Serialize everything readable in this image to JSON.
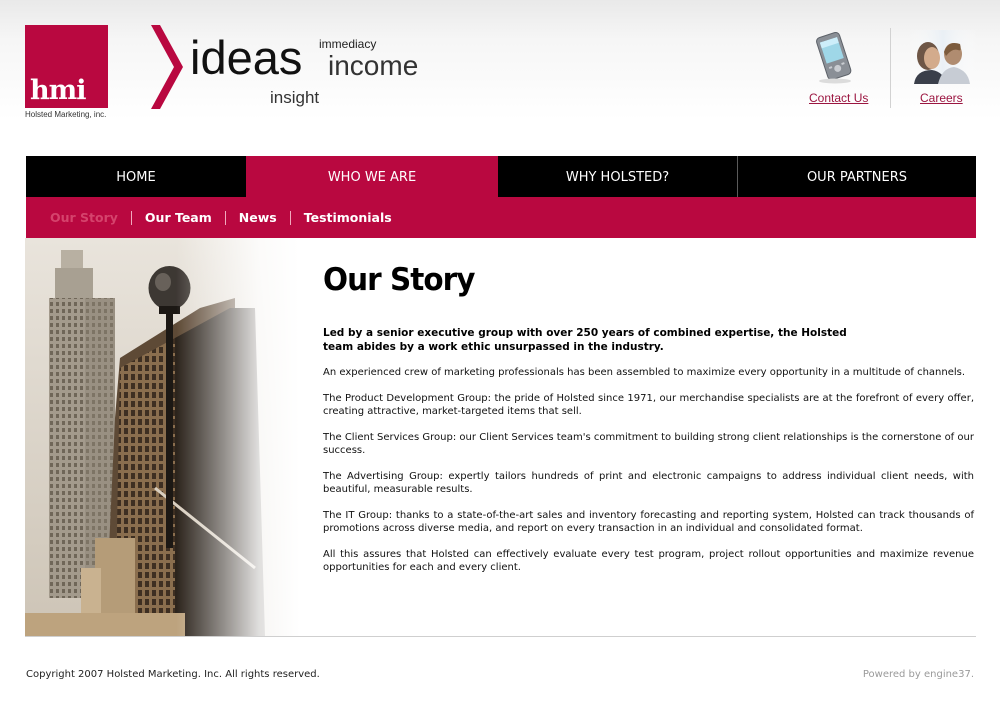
{
  "header": {
    "logo_text": "hmi",
    "logo_subtitle": "Holsted Marketing, inc.",
    "tagline": {
      "ideas": "ideas",
      "immediacy": "immediacy",
      "income": "income",
      "insight": "insight"
    },
    "contact_label": "Contact Us",
    "careers_label": "Careers"
  },
  "main_nav": [
    {
      "label": "HOME",
      "active": false
    },
    {
      "label": "WHO WE ARE",
      "active": true
    },
    {
      "label": "WHY HOLSTED?",
      "active": false
    },
    {
      "label": "OUR PARTNERS",
      "active": false
    }
  ],
  "sub_nav": [
    {
      "label": "Our Story",
      "active": true
    },
    {
      "label": "Our Team",
      "active": false
    },
    {
      "label": "News",
      "active": false
    },
    {
      "label": "Testimonials",
      "active": false
    }
  ],
  "content": {
    "title": "Our Story",
    "lead": "Led by a senior executive group with over 250 years of combined expertise, the Holsted team abides by a work ethic unsurpassed in the industry.",
    "paragraphs": [
      "An experienced crew of marketing professionals has been assembled to maximize every opportunity in a multitude of channels.",
      "The Product Development Group: the pride of Holsted since 1971, our merchandise specialists are at the forefront of every offer, creating attractive, market-targeted items that sell.",
      "The Client Services Group: our Client Services team's commitment to building strong client relationships is the cornerstone of our success.",
      "The Advertising Group: expertly tailors hundreds of print and electronic campaigns to address individual client needs, with beautiful, measurable results.",
      "The IT Group: thanks to a state-of-the-art sales and inventory forecasting and reporting system, Holsted can track thousands of promotions across diverse media, and report on every transaction in an individual and consolidated format.",
      "All this assures that Holsted can effectively evaluate every test program, project rollout opportunities and maximize revenue opportunities for each and every client."
    ]
  },
  "footer": {
    "copyright": "Copyright 2007 Holsted Marketing. Inc. All rights reserved.",
    "powered_by": "Powered by engine37."
  },
  "colors": {
    "brand": "#b90840",
    "nav_bg": "#000000",
    "active_sub": "#d5436c",
    "link": "#9b1540"
  },
  "icons": {
    "contact": "pda-phone-icon",
    "careers": "business-people-icon"
  }
}
